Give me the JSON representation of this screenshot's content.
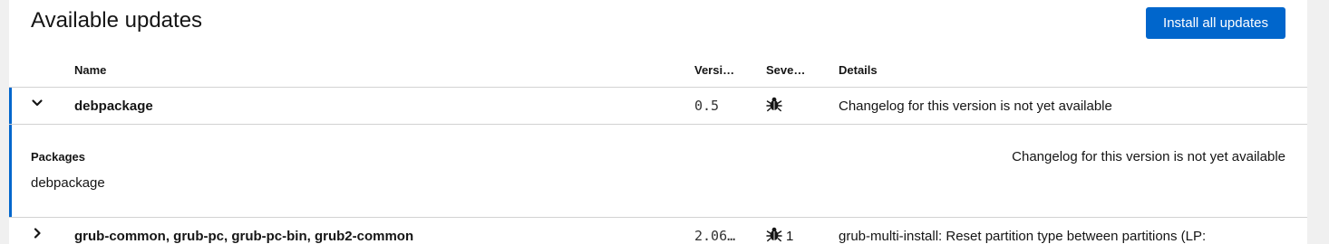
{
  "header": {
    "title": "Available updates",
    "install_all_label": "Install all updates"
  },
  "table": {
    "columns": {
      "name": "Name",
      "version": "Versi…",
      "severity": "Seve…",
      "details": "Details"
    },
    "rows": [
      {
        "name": "debpackage",
        "version": "0.5",
        "severity_icon": "bug-icon",
        "severity_count": "",
        "details": "Changelog for this version is not yet available",
        "expanded": true,
        "expanded_panel": {
          "packages_label": "Packages",
          "packages_value": "debpackage",
          "changelog": "Changelog for this version is not yet available"
        }
      },
      {
        "name": "grub-common, grub-pc, grub-pc-bin, grub2-common",
        "version": "2.06…",
        "severity_icon": "bug-icon",
        "severity_count": "1",
        "details": "grub-multi-install: Reset partition type between partitions (LP:",
        "expanded": false
      }
    ]
  },
  "colors": {
    "accent": "#0066cc",
    "border": "#d2d2d2",
    "background": "#f0f0f0"
  }
}
